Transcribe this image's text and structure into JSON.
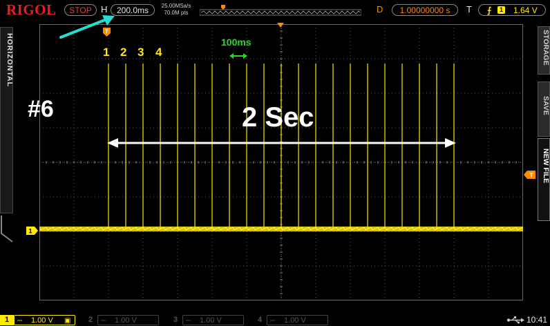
{
  "header": {
    "brand": "RIGOL",
    "run_state": "STOP",
    "horizontal_label": "H",
    "timebase": "200.0ms",
    "sample_rate": "25.00MSa/s",
    "memory_depth": "70.0M pts",
    "delay_label": "D",
    "delay_value": "1.00000000 s",
    "trigger_label": "T",
    "trigger_edge": "⨍",
    "trigger_channel": "1",
    "trigger_level": "1.64 V"
  },
  "left_panel": {
    "tab_label": "HORIZONTAL"
  },
  "right_panel": {
    "tabs": [
      "STORAGE",
      "SAVE",
      "NEW FILE"
    ]
  },
  "overlays": {
    "pulse_labels": [
      "1",
      "2",
      "3",
      "4"
    ],
    "period_label": "100ms",
    "clip_label": "#6",
    "duration_label": "2 Sec"
  },
  "markers": {
    "trigger_pos": "T",
    "channel1": "1",
    "trigger_level_marker": "T"
  },
  "waveform": {
    "pulse_count": 21,
    "pulse_period_s": 0.1,
    "color": "#ffea00"
  },
  "channels": [
    {
      "num": "1",
      "scale": "1.00 V",
      "active": true,
      "color": "#ffea00"
    },
    {
      "num": "2",
      "scale": "1.00 V",
      "active": false,
      "color": "#777777"
    },
    {
      "num": "3",
      "scale": "1.00 V",
      "active": false,
      "color": "#777777"
    },
    {
      "num": "4",
      "scale": "1.00 V",
      "active": false,
      "color": "#777777"
    }
  ],
  "status": {
    "usb_icon": "usb-icon",
    "time": "10:41"
  },
  "colors": {
    "accent_red": "#ee1c1c",
    "delay_orange": "#ff8a00",
    "ch1_yellow": "#ffea00",
    "annotation_green": "#22dd22",
    "arrow_cyan": "#22e0d0"
  }
}
